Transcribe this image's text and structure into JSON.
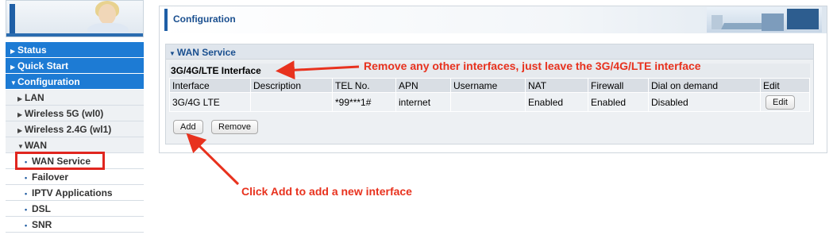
{
  "sidebar": {
    "menu": [
      {
        "label": "Status",
        "level": "top",
        "icon": "caret-right"
      },
      {
        "label": "Quick Start",
        "level": "top",
        "icon": "caret-right"
      },
      {
        "label": "Configuration",
        "level": "top",
        "icon": "caret-down"
      },
      {
        "label": "LAN",
        "level": "sub",
        "icon": "caret-right"
      },
      {
        "label": "Wireless 5G (wl0)",
        "level": "sub",
        "icon": "caret-right"
      },
      {
        "label": "Wireless 2.4G (wl1)",
        "level": "sub",
        "icon": "caret-right"
      },
      {
        "label": "WAN",
        "level": "sub",
        "icon": "caret-down"
      },
      {
        "label": "WAN Service",
        "level": "subsub",
        "icon": "bullet"
      },
      {
        "label": "Failover",
        "level": "subsub",
        "icon": "bullet"
      },
      {
        "label": "IPTV Applications",
        "level": "subsub",
        "icon": "bullet"
      },
      {
        "label": "DSL",
        "level": "subsub",
        "icon": "bullet"
      },
      {
        "label": "SNR",
        "level": "subsub",
        "icon": "bullet"
      }
    ]
  },
  "header": {
    "title": "Configuration"
  },
  "wan_service": {
    "section_label": "WAN Service",
    "interface_title": "3G/4G/LTE Interface",
    "columns": [
      "Interface",
      "Description",
      "TEL No.",
      "APN",
      "Username",
      "NAT",
      "Firewall",
      "Dial on demand",
      "Edit"
    ],
    "rows": [
      {
        "interface": "3G/4G LTE",
        "description": "",
        "tel": "*99***1#",
        "apn": "internet",
        "username": "",
        "nat": "Enabled",
        "firewall": "Enabled",
        "dial": "Disabled",
        "edit_label": "Edit"
      }
    ],
    "add_label": "Add",
    "remove_label": "Remove"
  },
  "annotations": {
    "top": "Remove any other interfaces, just leave the 3G/4G/LTE interface",
    "bottom": "Click Add to add a new interface",
    "color": "#e8321e"
  },
  "colors": {
    "menu_blue": "#1d7bd4",
    "title_blue": "#1a4f8f",
    "highlight_red": "#e0261f"
  }
}
